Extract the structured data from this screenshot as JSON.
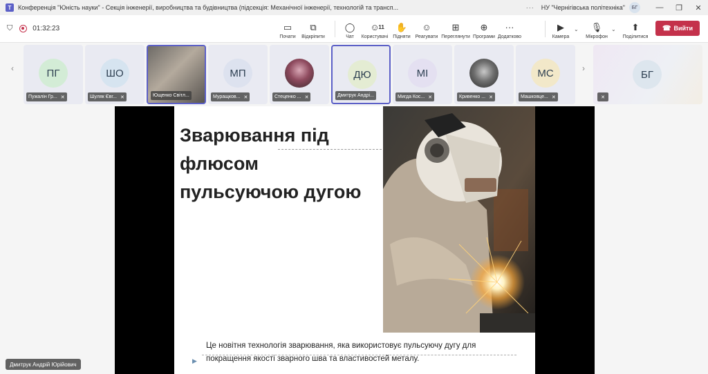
{
  "window": {
    "title": "Конференція \"Юність науки\" - Секція інженерії, виробництва та будівництва (підсекція: Механічної інженерії, технологій та трансп...",
    "more": "···",
    "org": "НУ \"Чернігівська політехніка\"",
    "org_initials": "БГ",
    "controls": [
      "—",
      "❐",
      "✕"
    ]
  },
  "toolbar": {
    "timer": "01:32:23",
    "buttons": [
      {
        "label": "Почати",
        "icon": "share-screen-icon"
      },
      {
        "label": "Відкріпити",
        "icon": "unpin-icon"
      },
      {
        "label": "Чат",
        "icon": "chat-icon"
      },
      {
        "label": "Користувачі",
        "icon": "people-icon",
        "count": "11"
      },
      {
        "label": "Підняти",
        "icon": "raise-hand-icon"
      },
      {
        "label": "Реагувати",
        "icon": "react-icon"
      },
      {
        "label": "Переглянути",
        "icon": "view-icon"
      },
      {
        "label": "Програми",
        "icon": "apps-icon"
      },
      {
        "label": "Додатково",
        "icon": "more-icon"
      },
      {
        "label": "Камера",
        "icon": "camera-off-icon"
      },
      {
        "label": "Мікрофон",
        "icon": "mic-off-icon"
      },
      {
        "label": "Поділитися",
        "icon": "share-icon"
      }
    ],
    "leave_label": "Вийти"
  },
  "participants": [
    {
      "initials": "ПГ",
      "name": "Пужалін Гр...",
      "color": "#d3ecd6",
      "active": false
    },
    {
      "initials": "ШО",
      "name": "Шуляк Євг...",
      "color": "#d6e4f0",
      "active": false
    },
    {
      "initials": "",
      "name": "Ющенко Світл...",
      "color": "",
      "active": true
    },
    {
      "initials": "МП",
      "name": "Муращков...",
      "color": "#dde2ef",
      "active": false
    },
    {
      "initials": "",
      "name": "Стеценко ...",
      "color": "",
      "active": false
    },
    {
      "initials": "ДЮ",
      "name": "Дмитрук Андрі...",
      "color": "#e4ecd3",
      "active": true
    },
    {
      "initials": "МІ",
      "name": "Мигда Кос...",
      "color": "#e4e0f1",
      "active": false
    },
    {
      "initials": "",
      "name": "Кривенко ...",
      "color": "",
      "active": false
    },
    {
      "initials": "МС",
      "name": "Машковце...",
      "color": "#f2e8c9",
      "active": false
    }
  ],
  "big_tile": {
    "initials": "БГ"
  },
  "slide": {
    "title_lines": [
      "Зварювання під",
      "флюсом",
      "пульсуючою дугою"
    ],
    "body": "Це новітня технологія зварювання, яка використовує пульсуючу дугу для покращення якості зварного шва та властивостей металу."
  },
  "speaker_label": "Дмитрук Андрій Юрійович"
}
